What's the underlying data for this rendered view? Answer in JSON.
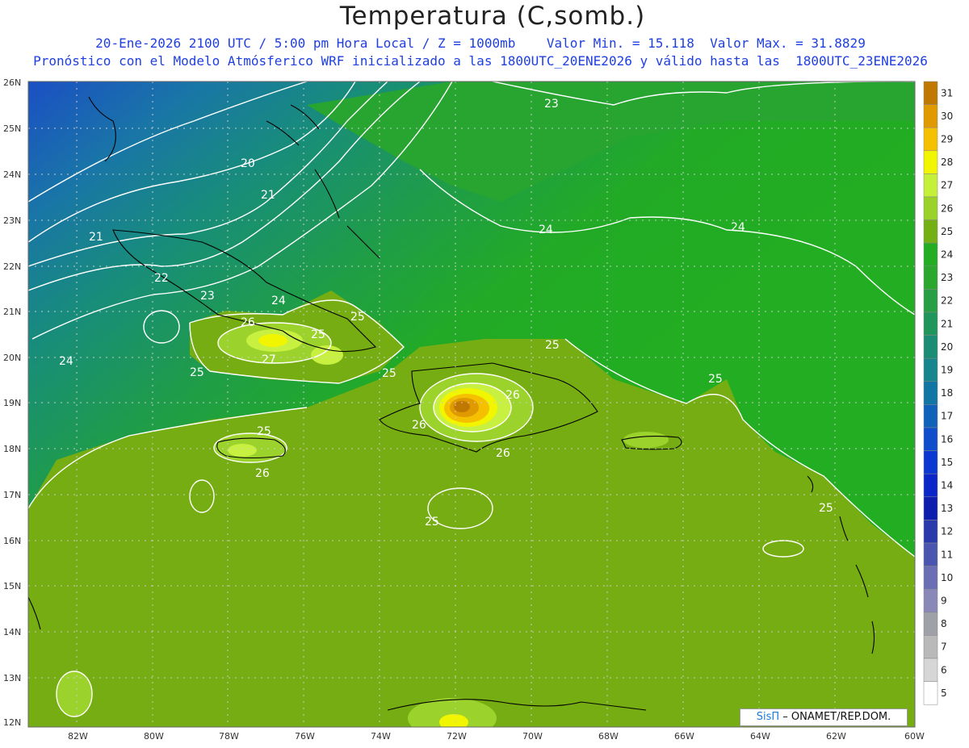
{
  "header": {
    "title": "Temperatura (C,somb.)",
    "subtitle_line1": "20-Ene-2026 2100 UTC / 5:00 pm Hora Local / Z = 1000mb    Valor Min. = 15.118  Valor Max. = 31.8829",
    "subtitle_line2": "Pronóstico con el Modelo Atmósferico WRF inicializado a las 1800UTC_20ENE2026 y válido hasta las  1800UTC_23ENE2026"
  },
  "map": {
    "lon_ticks": [
      "82W",
      "80W",
      "78W",
      "76W",
      "74W",
      "72W",
      "70W",
      "68W",
      "66W",
      "64W",
      "62W",
      "60W"
    ],
    "lat_ticks": [
      "26N",
      "25N",
      "24N",
      "23N",
      "22N",
      "21N",
      "20N",
      "19N",
      "18N",
      "17N",
      "16N",
      "15N",
      "14N",
      "13N",
      "12N"
    ],
    "contour_labels": [
      "20",
      "21",
      "21",
      "22",
      "23",
      "24",
      "23",
      "24",
      "24",
      "24",
      "25",
      "26",
      "25",
      "27",
      "25",
      "25",
      "25",
      "25",
      "26",
      "26",
      "26",
      "25",
      "26",
      "25",
      "25",
      "25",
      "24",
      "25",
      "25"
    ]
  },
  "colorbar": {
    "levels": [
      "31",
      "30",
      "29",
      "28",
      "27",
      "26",
      "25",
      "24",
      "23",
      "22",
      "21",
      "20",
      "19",
      "18",
      "17",
      "16",
      "15",
      "14",
      "13",
      "12",
      "11",
      "10",
      "9",
      "8",
      "7",
      "6",
      "5"
    ],
    "colors": [
      "#c07800",
      "#e09a00",
      "#f5c000",
      "#f2f500",
      "#c5f03a",
      "#9ad22a",
      "#74b014",
      "#22ad22",
      "#2ba72e",
      "#289e45",
      "#21965c",
      "#1b8d74",
      "#16858d",
      "#1176a3",
      "#1061ba",
      "#0e4dcb",
      "#0c38d2",
      "#0a26c8",
      "#0d1dae",
      "#2a3aad",
      "#4a55b0",
      "#6a6fb5",
      "#8a88b8",
      "#a0a0a8",
      "#b9b9b9",
      "#d6d6d6",
      "#ffffff"
    ]
  },
  "credit": {
    "brand": "SisΠ",
    "text": " – ONAMET/REP.DOM."
  }
}
